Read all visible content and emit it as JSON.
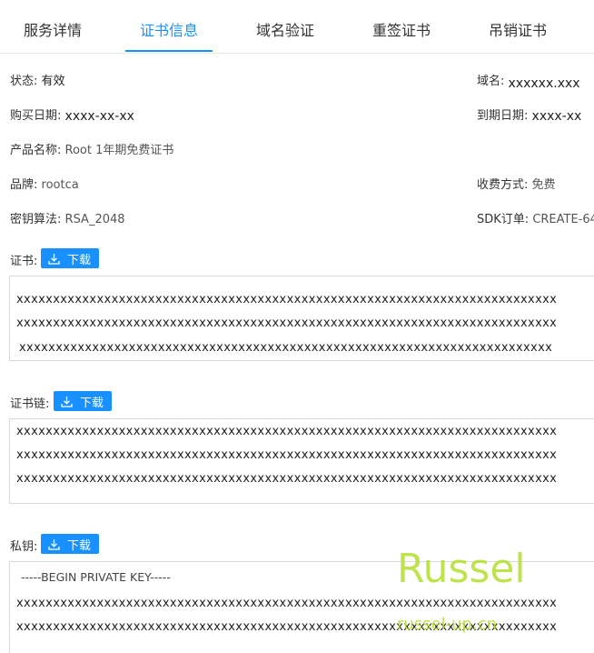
{
  "tabs": [
    {
      "label": "服务详情"
    },
    {
      "label": "证书信息"
    },
    {
      "label": "域名验证"
    },
    {
      "label": "重签证书"
    },
    {
      "label": "吊销证书"
    }
  ],
  "info": {
    "status_label": "状态:",
    "status_value": "有效",
    "domain_label": "域名:",
    "domain_value": "xxxxxx.xxx",
    "purchase_label": "购买日期:",
    "purchase_value": "xxxx-xx-xx",
    "expire_label": "到期日期:",
    "expire_value": "xxxx-xx",
    "product_label": "产品名称:",
    "product_value": "Root 1年期免费证书",
    "brand_label": "品牌:",
    "brand_value": "rootca",
    "fee_label": "收费方式:",
    "fee_value": "免费",
    "algo_label": "密钥算法:",
    "algo_value": "RSA_2048",
    "sdk_label": "SDK订单:",
    "sdk_value": "CREATE-64"
  },
  "certificate": {
    "label": "证书:",
    "download_label": "下载",
    "lines": [
      "xxxxxxxxxxxxxxxxxxxxxxxxxxxxxxxxxxxxxxxxxxxxxxxxxxxxxxxxxxxxxxxxxxxxxxxxxx",
      "xxxxxxxxxxxxxxxxxxxxxxxxxxxxxxxxxxxxxxxxxxxxxxxxxxxxxxxxxxxxxxxxxxxxxxxxxx",
      "xxxxxxxxxxxxxxxxxxxxxxxxxxxxxxxxxxxxxxxxxxxxxxxxxxxxxxxxxxxxxxxxxxxxxxxxx"
    ]
  },
  "chain": {
    "label": "证书链:",
    "download_label": "下载",
    "lines": [
      "xxxxxxxxxxxxxxxxxxxxxxxxxxxxxxxxxxxxxxxxxxxxxxxxxxxxxxxxxxxxxxxxxxxxxxxxxx",
      "xxxxxxxxxxxxxxxxxxxxxxxxxxxxxxxxxxxxxxxxxxxxxxxxxxxxxxxxxxxxxxxxxxxxxxxxxx",
      "xxxxxxxxxxxxxxxxxxxxxxxxxxxxxxxxxxxxxxxxxxxxxxxxxxxxxxxxxxxxxxxxxxxxxxxxxx"
    ]
  },
  "private_key": {
    "label": "私钥:",
    "download_label": "下载",
    "header": "-----BEGIN PRIVATE KEY-----",
    "lines": [
      "xxxxxxxxxxxxxxxxxxxxxxxxxxxxxxxxxxxxxxxxxxxxxxxxxxxxxxxxxxxxxxxxxxxxxxxxxx",
      "xxxxxxxxxxxxxxxxxxxxxxxxxxxxxxxxxxxxxxxxxxxxxxxxxxxxxxxxxxxxxxxxxxxxxxxxxx"
    ]
  },
  "watermark": {
    "title": "Russel",
    "url": "russel-up.cn"
  },
  "colors": {
    "accent": "#1890ff",
    "watermark": "#b8e03a"
  }
}
